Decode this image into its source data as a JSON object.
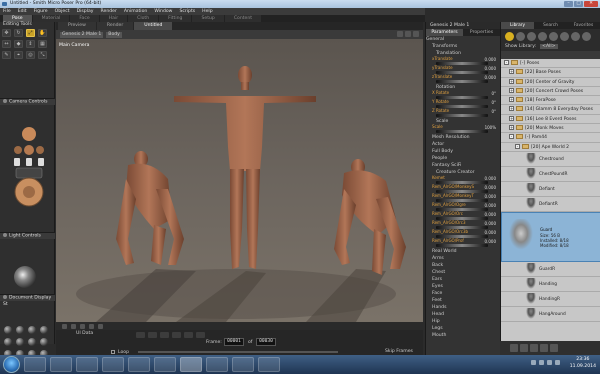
{
  "window": {
    "title": "Untitled - Smith Micro Poser Pro (64-bit)",
    "min": "–",
    "max": "□",
    "close": "✕"
  },
  "menu": [
    "File",
    "Edit",
    "Figure",
    "Object",
    "Display",
    "Render",
    "Animation",
    "Window",
    "Scripts",
    "Help"
  ],
  "room_tabs": [
    {
      "label": "Pose",
      "active": true
    },
    {
      "label": "Material"
    },
    {
      "label": "Face"
    },
    {
      "label": "Hair"
    },
    {
      "label": "Cloth"
    },
    {
      "label": "Fitting"
    },
    {
      "label": "Setup"
    },
    {
      "label": "Content"
    }
  ],
  "left": {
    "editing_tools": "Editing Tools",
    "tools": [
      "✥",
      "↻",
      "⤢",
      "✋",
      "↔",
      "◆",
      "⇕",
      "▦",
      "✎",
      "⌖",
      "◎",
      "⤡"
    ],
    "camera_controls": "Camera Controls",
    "light_controls": "Light Controls",
    "document_display": "Document Display St"
  },
  "viewport": {
    "tabs": [
      "Preview",
      "Render",
      "Untitled"
    ],
    "figure_select": "Genesis 2 Male 1",
    "part_select": "Body",
    "camera_label": "Main Camera"
  },
  "timeline": {
    "uidata": "UI Data",
    "frame_label": "Frame:",
    "frame": "00001",
    "of": "of",
    "total": "00030",
    "loop": "Loop",
    "step_frames": "Skip Frames"
  },
  "props": {
    "title": "Genesis 2 Male 1",
    "tabs": [
      "Parameters",
      "Properties"
    ],
    "general": "General",
    "transforms": "Transforms",
    "translation": "Translation",
    "sliders_translation": [
      {
        "name": "xTranslate",
        "value": "0.000"
      },
      {
        "name": "yTranslate",
        "value": "0.000"
      },
      {
        "name": "zTranslate",
        "value": "0.000"
      }
    ],
    "rotation": "Rotation",
    "sliders_rotation": [
      {
        "name": "X Rotate",
        "value": "0°"
      },
      {
        "name": "Y Rotate",
        "value": "0°"
      },
      {
        "name": "Z Rotate",
        "value": "0°"
      }
    ],
    "scale": "Scale",
    "sliders_scale": [
      {
        "name": "Scale",
        "value": "100%"
      }
    ],
    "rows_mid": [
      "Mesh Resolution",
      "Actor",
      "Full Body",
      "People",
      "Fantasy SciFi",
      "Creature Creator"
    ],
    "sliders_morph": [
      {
        "name": "Kemet",
        "value": "0.000"
      },
      {
        "name": "Rem_AlrGO/MonkeyS",
        "value": "0.000"
      },
      {
        "name": "Rem_AlrGO/MonkeyT",
        "value": "0.000"
      },
      {
        "name": "Rem_AlrGO/Ogre",
        "value": "0.000"
      },
      {
        "name": "Rem_AlrGO/Orc",
        "value": "0.000"
      },
      {
        "name": "Rem_AlrGO/Orc3",
        "value": "0.000"
      },
      {
        "name": "Rem_AlrGO/Orc3b",
        "value": "0.000"
      },
      {
        "name": "Rem_AlrGO/Prof",
        "value": "0.000"
      }
    ],
    "rows_bottom": [
      "Real World",
      "Arms",
      "Back",
      "Chest",
      "Ears",
      "Eyes",
      "Face",
      "Feet",
      "Hands",
      "Head",
      "Hip",
      "Legs",
      "Mouth"
    ]
  },
  "library": {
    "tabs": [
      "Library",
      "Search",
      "Favorites"
    ],
    "show_label": "Show Library:",
    "show_value": "<All>",
    "rows": [
      {
        "text": "[-] Poses",
        "level": 0
      },
      {
        "text": "[22] Base Poses",
        "level": 1
      },
      {
        "text": "[20] Center of Gravity",
        "level": 1
      },
      {
        "text": "[20] Concert Crowd Poses",
        "level": 1
      },
      {
        "text": "[18] FeraPose",
        "level": 1
      },
      {
        "text": "[14] Glamm 8 Everyday Poses",
        "level": 1
      },
      {
        "text": "[16] Lee 8 Everd Poses",
        "level": 1
      },
      {
        "text": "[20] Monk Moves",
        "level": 1
      },
      {
        "text": "[-] Pam44",
        "level": 1
      },
      {
        "text": "[20] Ape World 2",
        "level": 2
      }
    ],
    "thumbs_top": [
      "Chestround",
      "ChestPoundR",
      "Defiant",
      "DefiantR"
    ],
    "selected": {
      "name": "Guard",
      "size": "Size: 56 B",
      "installed": "Installed: 8/18",
      "modified": "Modified: 8/18"
    },
    "thumbs_bottom": [
      "GuardR",
      "Handing",
      "HandingR",
      "HangAround"
    ]
  },
  "taskbar": {
    "time": "23:36",
    "date": "11.09.2014"
  },
  "colors": {
    "accent": "#d8b020",
    "library_selection": "#8cb4d6",
    "viewport": "#6c655e"
  }
}
